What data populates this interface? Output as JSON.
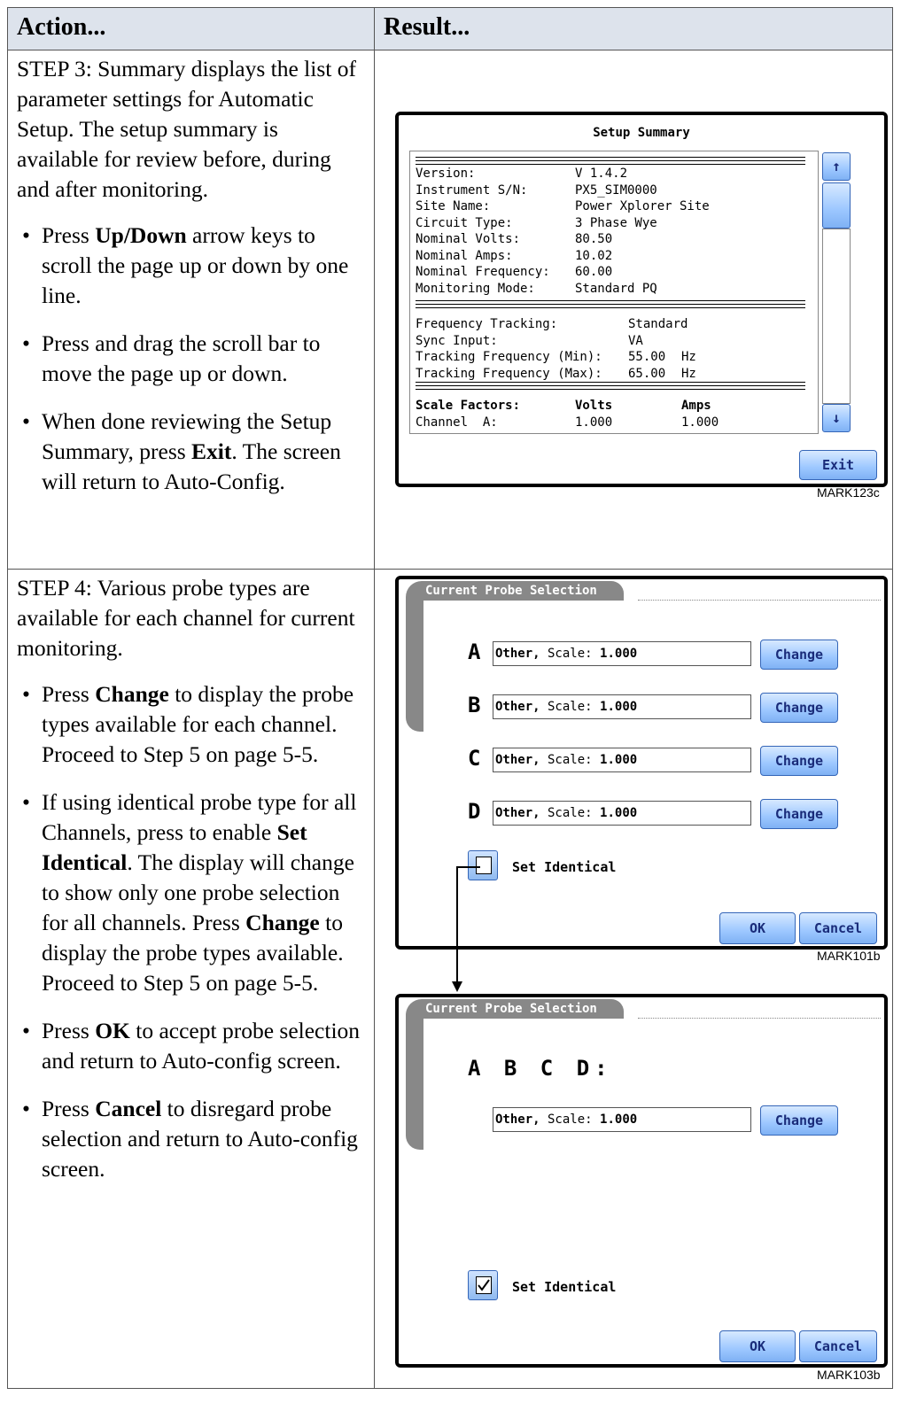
{
  "table": {
    "col1_header": "Action...",
    "col2_header": "Result..."
  },
  "step3": {
    "intro": "STEP 3: Summary displays the list of parameter settings for Automatic Setup. The setup summary is available for review before, during and after monitoring.",
    "bullet1": {
      "pre": "Press ",
      "bold": "Up/Down",
      "post": " arrow keys to scroll the page up or down by one line."
    },
    "bullet2": "Press and drag the scroll bar to move the page up or down.",
    "bullet3": {
      "pre": "When done reviewing the Setup Summary, press ",
      "bold": "Exit",
      "post": ". The screen will return to Auto-Config."
    },
    "figure_label": "MARK123c"
  },
  "setup_summary": {
    "title": "Setup Summary",
    "rows1": [
      {
        "key": "Version:",
        "val": "V 1.4.2"
      },
      {
        "key": "Instrument S/N:",
        "val": "PX5_SIM0000"
      },
      {
        "key": "Site Name:",
        "val": "Power Xplorer Site"
      },
      {
        "key": "Circuit Type:",
        "val": "3 Phase Wye"
      },
      {
        "key": "Nominal Volts:",
        "val": "80.50"
      },
      {
        "key": "Nominal Amps:",
        "val": "10.02"
      },
      {
        "key": "Nominal Frequency:",
        "val": "60.00"
      },
      {
        "key": "Monitoring Mode:",
        "val": "Standard PQ"
      }
    ],
    "rows2": [
      {
        "key": "Frequency Tracking:",
        "val": "Standard",
        "unit": ""
      },
      {
        "key": "Sync Input:",
        "val": "VA",
        "unit": ""
      },
      {
        "key": "Tracking Frequency (Min):",
        "val": "55.00",
        "unit": "Hz"
      },
      {
        "key": "Tracking Frequency (Max):",
        "val": "65.00",
        "unit": "Hz"
      }
    ],
    "scale_header": {
      "key": "Scale Factors:",
      "volts": "Volts",
      "amps": "Amps"
    },
    "channel_row": {
      "key": "Channel  A:",
      "volts": "1.000",
      "amps": "1.000"
    },
    "exit_label": "Exit",
    "scroll_up": "↑",
    "scroll_down": "↓"
  },
  "step4": {
    "intro": "STEP 4: Various probe types are available for each channel for current monitoring.",
    "bullet1": {
      "pre": "Press ",
      "bold": "Change",
      "post": " to display the probe types available for each channel. Proceed to Step 5 on page 5-5."
    },
    "bullet2": {
      "pre": "If using identical probe type for all Channels, press to enable ",
      "bold": "Set Identical",
      "mid": ". The display will change to show only one probe selection for all channels. Press ",
      "bold2": "Change",
      "post": " to display the probe types available. Proceed to Step 5 on page 5-5."
    },
    "bullet3": {
      "pre": "Press ",
      "bold": "OK",
      "post": " to accept probe selection and return to Auto-config screen."
    },
    "bullet4": {
      "pre": "Press ",
      "bold": "Cancel",
      "post": " to disregard probe selection and return to Auto-config screen."
    }
  },
  "probe_screen1": {
    "tab_title": "Current Probe Selection",
    "channels": [
      {
        "letter": "A",
        "probe": "Other,",
        "scale_label": " Scale:",
        "scale": "1.000"
      },
      {
        "letter": "B",
        "probe": "Other,",
        "scale_label": " Scale:",
        "scale": "1.000"
      },
      {
        "letter": "C",
        "probe": "Other,",
        "scale_label": " Scale:",
        "scale": "1.000"
      },
      {
        "letter": "D",
        "probe": "Other,",
        "scale_label": " Scale:",
        "scale": "1.000"
      }
    ],
    "change_label": "Change",
    "set_identical_label": "Set Identical",
    "set_identical_checked": false,
    "ok_label": "OK",
    "cancel_label": "Cancel",
    "figure_label": "MARK101b"
  },
  "probe_screen2": {
    "tab_title": "Current Probe Selection",
    "channels_label": "A B C D:",
    "probe": "Other,",
    "scale_label": " Scale:",
    "scale": "1.000",
    "change_label": "Change",
    "set_identical_label": "Set Identical",
    "set_identical_checked": true,
    "ok_label": "OK",
    "cancel_label": "Cancel",
    "figure_label": "MARK103b"
  },
  "colors": {
    "header_bg": "#dde3ec",
    "button_blue": "#9cc7ff",
    "tab_gray": "#888888"
  }
}
